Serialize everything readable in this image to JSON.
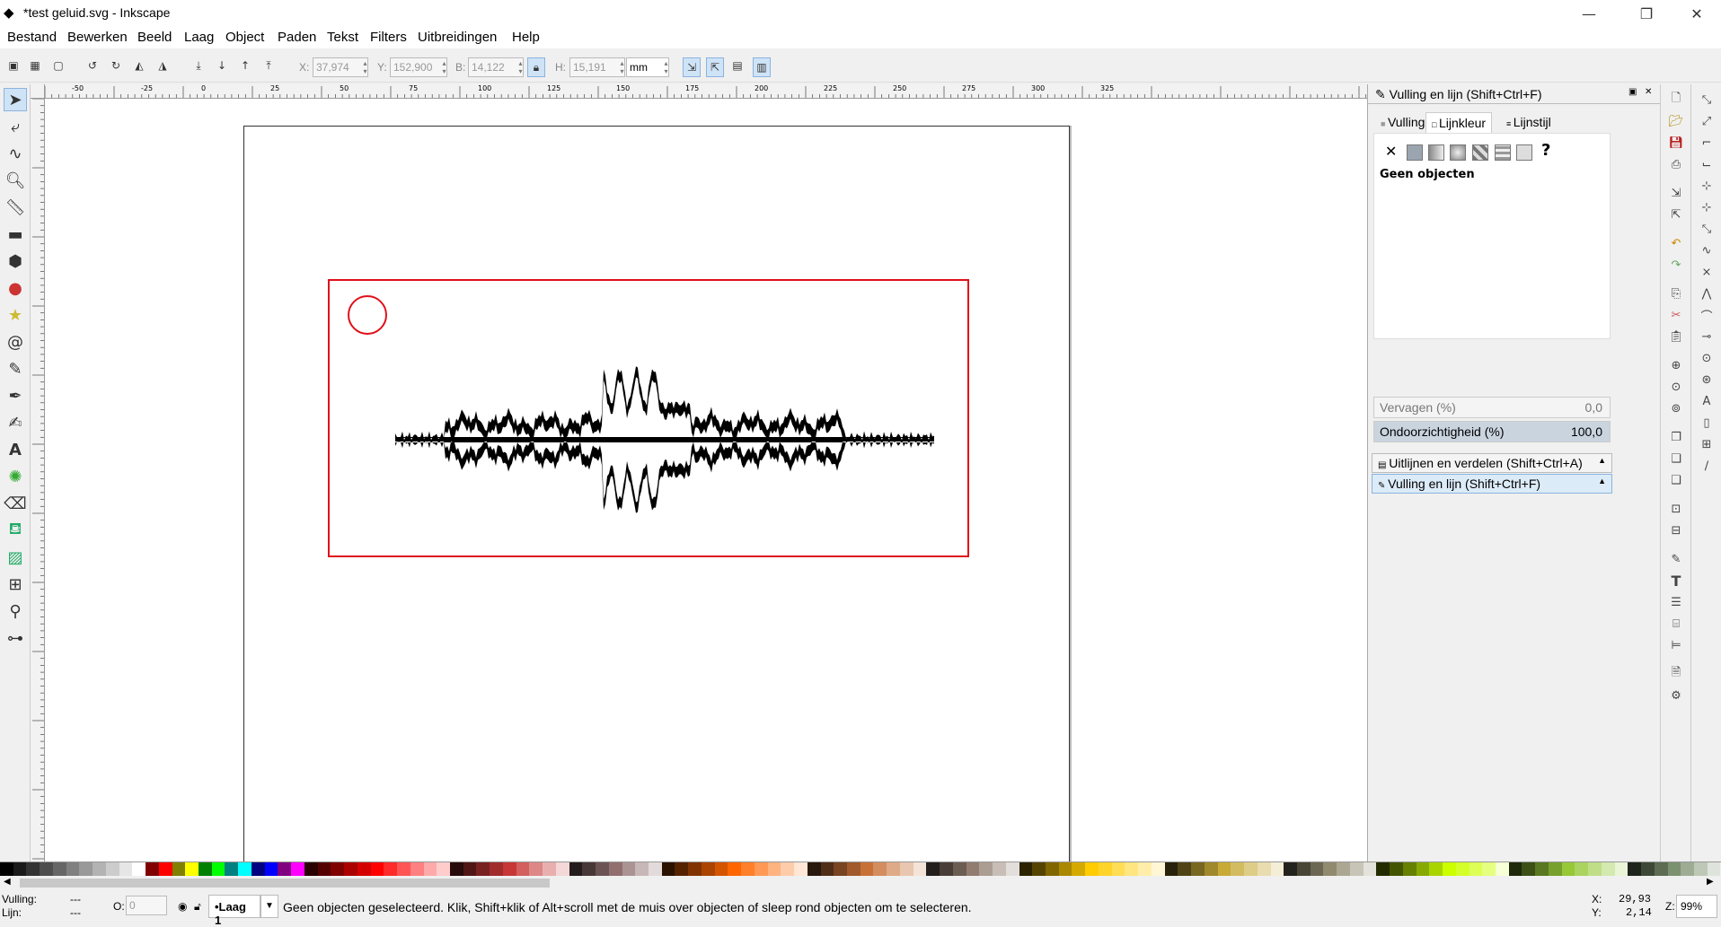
{
  "window": {
    "title": "*test geluid.svg - Inkscape",
    "minimize": "—",
    "maximize": "❐",
    "close": "✕"
  },
  "menu": [
    "Bestand",
    "Bewerken",
    "Beeld",
    "Laag",
    "Object",
    "Paden",
    "Tekst",
    "Filters",
    "Uitbreidingen",
    "Help"
  ],
  "toolbar": {
    "x_label": "X:",
    "x_value": "37,974",
    "y_label": "Y:",
    "y_value": "152,900",
    "w_label": "B:",
    "w_value": "14,122",
    "h_label": "H:",
    "h_value": "15,191",
    "unit": "mm"
  },
  "ruler": {
    "top_ticks": [
      "-50",
      "-25",
      "0",
      "25",
      "50",
      "75",
      "100",
      "125",
      "150",
      "175",
      "200",
      "225",
      "250",
      "275",
      "300",
      "325"
    ]
  },
  "dock": {
    "header": "Vulling en lijn (Shift+Ctrl+F)",
    "tabs": [
      "Vulling",
      "Lijnkleur",
      "Lijnstijl"
    ],
    "active_tab": "Lijnkleur",
    "no_paint": "✕",
    "unset": "?",
    "message": "Geen objecten",
    "blur_label": "Vervagen (%)",
    "blur_value": "0,0",
    "opacity_label": "Ondoorzichtigheid (%)",
    "opacity_value": "100,0",
    "panel_align": "Uitlijnen en verdelen (Shift+Ctrl+A)",
    "panel_fill": "Vulling en lijn (Shift+Ctrl+F)"
  },
  "status": {
    "fill_label": "Vulling:",
    "fill_value": "---",
    "stroke_label": "Lijn:",
    "stroke_value": "---",
    "opacity_label": "O:",
    "opacity_value": "0",
    "layer": "•Laag 1",
    "message": "Geen objecten geselecteerd. Klik, Shift+klik of Alt+scroll met de muis over objecten of sleep rond objecten om te selecteren.",
    "x_label": "X:",
    "x_value": "29,93",
    "y_label": "Y:",
    "y_value": "2,14",
    "zoom_label": "Z:",
    "zoom_value": "99%"
  },
  "colors": {
    "selection_red": "#e0101a",
    "accent": "#cfe3f7"
  },
  "icons": {
    "tools": [
      "selector-arrow-icon",
      "node-tool-icon",
      "tweak-tool-icon",
      "zoom-icon",
      "measure-icon",
      "rectangle-icon",
      "box3d-icon",
      "ellipse-icon",
      "star-icon",
      "spiral-icon",
      "pencil-icon",
      "pen-icon",
      "calligraphy-icon",
      "text-icon",
      "spray-icon",
      "eraser-icon",
      "paint-bucket-icon",
      "gradient-icon",
      "mesh-icon",
      "dropper-icon",
      "connector-icon"
    ]
  }
}
